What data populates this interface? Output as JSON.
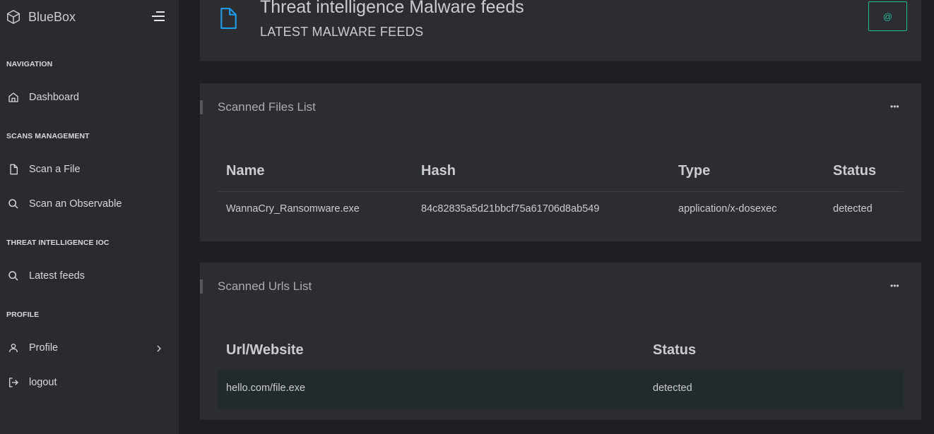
{
  "app": {
    "brand": "BlueBox"
  },
  "sidebar": {
    "sections": [
      {
        "heading": "NAVIGATION",
        "items": [
          {
            "label": "Dashboard",
            "icon": "home-icon"
          }
        ]
      },
      {
        "heading": "SCANS MANAGEMENT",
        "items": [
          {
            "label": "Scan a File",
            "icon": "file-icon"
          },
          {
            "label": "Scan an Observable",
            "icon": "search-icon"
          }
        ]
      },
      {
        "heading": "THREAT INTELLIGENCE IOC",
        "items": [
          {
            "label": "Latest feeds",
            "icon": "search-icon"
          }
        ]
      },
      {
        "heading": "PROFILE",
        "items": [
          {
            "label": "Profile",
            "icon": "user-icon"
          },
          {
            "label": "logout",
            "icon": "logout-icon"
          }
        ]
      }
    ]
  },
  "header": {
    "title": "Threat intelligence Malware feeds",
    "subtitle": "LATEST MALWARE FEEDS",
    "action_label": "@"
  },
  "files_card": {
    "title": "Scanned Files List",
    "menu_label": "•••",
    "columns": [
      "Name",
      "Hash",
      "Type",
      "Status"
    ],
    "rows": [
      [
        "WannaCry_Ransomware.exe",
        "84c82835a5d21bbcf75a61706d8ab549",
        "application/x-dosexec",
        "detected"
      ]
    ]
  },
  "urls_card": {
    "title": "Scanned Urls List",
    "menu_label": "•••",
    "columns": [
      "Url/Website",
      "Status"
    ],
    "rows": [
      [
        "hello.com/file.exe",
        "detected"
      ]
    ]
  },
  "colors": {
    "accent": "#1fb89a",
    "header_icon": "#1e9be9",
    "sidebar_bg": "#2a2b2e",
    "page_bg": "#1e1f22",
    "card_bg": "#2c2d30"
  }
}
